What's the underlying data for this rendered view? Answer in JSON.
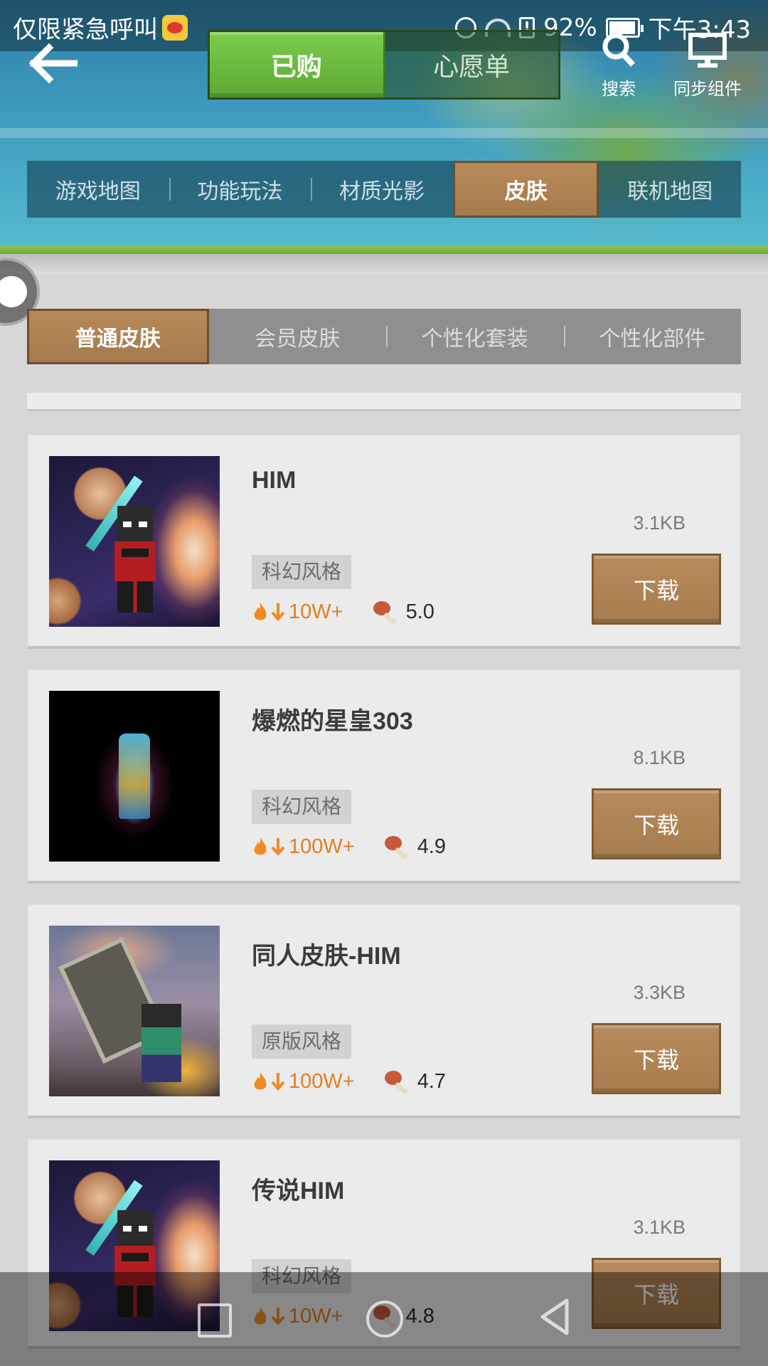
{
  "status_bar": {
    "carrier": "仅限紧急呼叫",
    "battery": "92%",
    "time": "下午3:43"
  },
  "header": {
    "back_icon": "arrow-left-icon",
    "purchase_tabs": [
      {
        "label": "已购",
        "active": true
      },
      {
        "label": "心愿单",
        "active": false
      }
    ],
    "search_label": "搜索",
    "sync_label": "同步组件"
  },
  "category_tabs": [
    {
      "label": "游戏地图",
      "active": false
    },
    {
      "label": "功能玩法",
      "active": false
    },
    {
      "label": "材质光影",
      "active": false
    },
    {
      "label": "皮肤",
      "active": true
    },
    {
      "label": "联机地图",
      "active": false
    }
  ],
  "sub_tabs": [
    {
      "label": "普通皮肤",
      "active": true
    },
    {
      "label": "会员皮肤",
      "active": false
    },
    {
      "label": "个性化套装",
      "active": false
    },
    {
      "label": "个性化部件",
      "active": false
    }
  ],
  "items": [
    {
      "title": "HIM",
      "tag": "科幻风格",
      "downloads": "10W+",
      "rating": "5.0",
      "size": "3.1KB",
      "button": "下载"
    },
    {
      "title": "爆燃的星皇303",
      "tag": "科幻风格",
      "downloads": "100W+",
      "rating": "4.9",
      "size": "8.1KB",
      "button": "下载"
    },
    {
      "title": "同人皮肤-HIM",
      "tag": "原版风格",
      "downloads": "100W+",
      "rating": "4.7",
      "size": "3.3KB",
      "button": "下载"
    },
    {
      "title": "传说HIM",
      "tag": "科幻风格",
      "downloads": "10W+",
      "rating": "4.8",
      "size": "3.1KB",
      "button": "下载"
    }
  ],
  "colors": {
    "accent_brown": "#a77c4e",
    "accent_green": "#5ba935",
    "download_count": "#e07f22"
  }
}
